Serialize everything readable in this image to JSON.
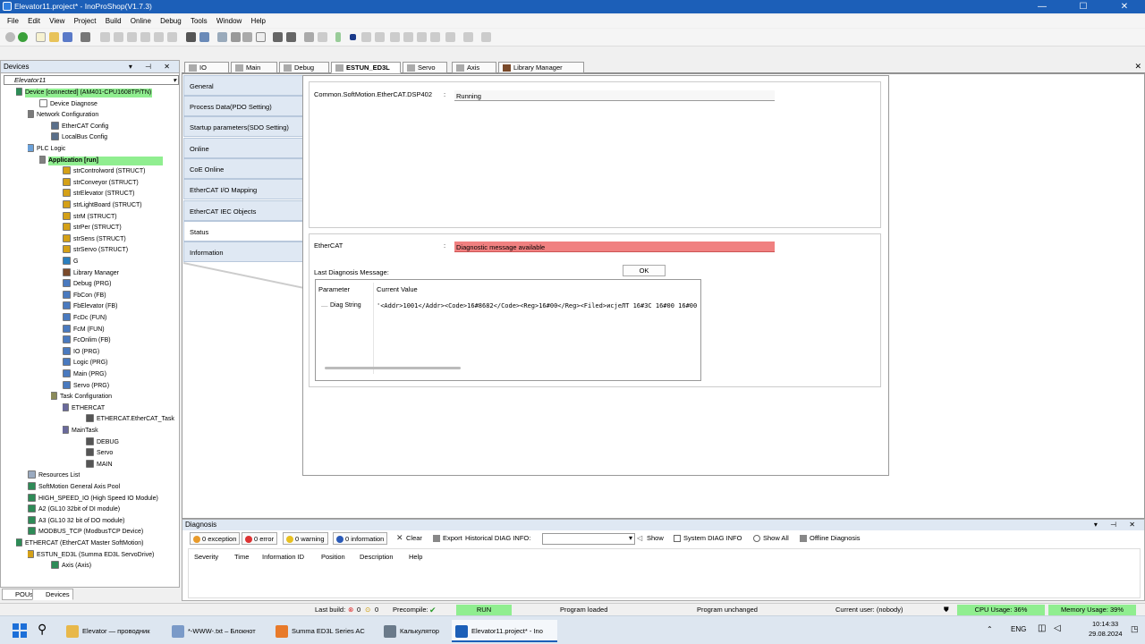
{
  "window": {
    "title": "Elevator11.project* - InoProShop(V1.7.3)",
    "minimize": "—",
    "maximize": "☐",
    "close": "✕"
  },
  "menu": [
    "File",
    "Edit",
    "View",
    "Project",
    "Build",
    "Online",
    "Debug",
    "Tools",
    "Window",
    "Help"
  ],
  "devices": {
    "title": "Devices",
    "header_controls": "▾ ⊣ ✕",
    "selector": "Elevator11",
    "tree": [
      {
        "label": "Device [connected] (AM401-CPU1608TP/TN)",
        "indent": 1,
        "expander": "−",
        "highlight": true,
        "icon": "#2e8b57"
      },
      {
        "label": "Device Diagnose",
        "indent": 3,
        "expander": "",
        "highlight": false,
        "icon": "#ffffff"
      },
      {
        "label": "Network Configuration",
        "indent": 2,
        "expander": "−",
        "highlight": false,
        "icon": "#7a7a7a"
      },
      {
        "label": "EtherCAT Config",
        "indent": 4,
        "expander": "",
        "highlight": false,
        "icon": "#5a6f8a"
      },
      {
        "label": "LocalBus Config",
        "indent": 4,
        "expander": "",
        "highlight": false,
        "icon": "#5a6f8a"
      },
      {
        "label": "PLC Logic",
        "indent": 2,
        "expander": "−",
        "highlight": false,
        "icon": "#6aa0d8"
      },
      {
        "label": "Application [run]",
        "indent": 3,
        "expander": "−",
        "highlight": true,
        "bold": true,
        "icon": "#808080"
      },
      {
        "label": "strControlword (STRUCT)",
        "indent": 5,
        "expander": "",
        "highlight": false,
        "icon": "#d4a017"
      },
      {
        "label": "strConveyor (STRUCT)",
        "indent": 5,
        "expander": "",
        "highlight": false,
        "icon": "#d4a017"
      },
      {
        "label": "strElevator (STRUCT)",
        "indent": 5,
        "expander": "",
        "highlight": false,
        "icon": "#d4a017"
      },
      {
        "label": "strLightBoard (STRUCT)",
        "indent": 5,
        "expander": "",
        "highlight": false,
        "icon": "#d4a017"
      },
      {
        "label": "strM (STRUCT)",
        "indent": 5,
        "expander": "",
        "highlight": false,
        "icon": "#d4a017"
      },
      {
        "label": "strPer (STRUCT)",
        "indent": 5,
        "expander": "",
        "highlight": false,
        "icon": "#d4a017"
      },
      {
        "label": "strSens (STRUCT)",
        "indent": 5,
        "expander": "",
        "highlight": false,
        "icon": "#d4a017"
      },
      {
        "label": "strServo (STRUCT)",
        "indent": 5,
        "expander": "",
        "highlight": false,
        "icon": "#d4a017"
      },
      {
        "label": "G",
        "indent": 5,
        "expander": "",
        "highlight": false,
        "icon": "#2a7fbf"
      },
      {
        "label": "Library Manager",
        "indent": 5,
        "expander": "",
        "highlight": false,
        "icon": "#7a4a2a"
      },
      {
        "label": "Debug (PRG)",
        "indent": 5,
        "expander": "",
        "highlight": false,
        "icon": "#4a7abf"
      },
      {
        "label": "FbCon (FB)",
        "indent": 5,
        "expander": "",
        "highlight": false,
        "icon": "#4a7abf"
      },
      {
        "label": "FbElevator (FB)",
        "indent": 5,
        "expander": "",
        "highlight": false,
        "icon": "#4a7abf"
      },
      {
        "label": "FcDc (FUN)",
        "indent": 5,
        "expander": "",
        "highlight": false,
        "icon": "#4a7abf"
      },
      {
        "label": "FcM (FUN)",
        "indent": 5,
        "expander": "",
        "highlight": false,
        "icon": "#4a7abf"
      },
      {
        "label": "FcOnlim (FB)",
        "indent": 5,
        "expander": "",
        "highlight": false,
        "icon": "#4a7abf"
      },
      {
        "label": "IO (PRG)",
        "indent": 5,
        "expander": "",
        "highlight": false,
        "icon": "#4a7abf"
      },
      {
        "label": "Logic (PRG)",
        "indent": 5,
        "expander": "",
        "highlight": false,
        "icon": "#4a7abf"
      },
      {
        "label": "Main (PRG)",
        "indent": 5,
        "expander": "",
        "highlight": false,
        "icon": "#4a7abf"
      },
      {
        "label": "Servo (PRG)",
        "indent": 5,
        "expander": "",
        "highlight": false,
        "icon": "#4a7abf"
      },
      {
        "label": "Task Configuration",
        "indent": 4,
        "expander": "−",
        "highlight": false,
        "icon": "#8a8a5a"
      },
      {
        "label": "ETHERCAT",
        "indent": 5,
        "expander": "−",
        "highlight": false,
        "icon": "#6a6a9a"
      },
      {
        "label": "ETHERCAT.EtherCAT_Task",
        "indent": 7,
        "expander": "",
        "highlight": false,
        "icon": "#555555"
      },
      {
        "label": "MainTask",
        "indent": 5,
        "expander": "−",
        "highlight": false,
        "icon": "#6a6a9a"
      },
      {
        "label": "DEBUG",
        "indent": 7,
        "expander": "",
        "highlight": false,
        "icon": "#555555"
      },
      {
        "label": "Servo",
        "indent": 7,
        "expander": "",
        "highlight": false,
        "icon": "#555555"
      },
      {
        "label": "MAIN",
        "indent": 7,
        "expander": "",
        "highlight": false,
        "icon": "#555555"
      },
      {
        "label": "Resources List",
        "indent": 2,
        "expander": "",
        "highlight": false,
        "icon": "#9aaac0"
      },
      {
        "label": "SoftMotion General Axis Pool",
        "indent": 2,
        "expander": "",
        "highlight": false,
        "icon": "#2e8b57"
      },
      {
        "label": "HIGH_SPEED_IO (High Speed IO Module)",
        "indent": 2,
        "expander": "",
        "highlight": false,
        "icon": "#2e8b57"
      },
      {
        "label": "A2 (GL10 32bit of DI module)",
        "indent": 2,
        "expander": "",
        "highlight": false,
        "icon": "#2e8b57"
      },
      {
        "label": "A3 (GL10 32 bit of DO module)",
        "indent": 2,
        "expander": "",
        "highlight": false,
        "icon": "#2e8b57"
      },
      {
        "label": "MODBUS_TCP (ModbusTCP Device)",
        "indent": 2,
        "expander": "",
        "highlight": false,
        "icon": "#2e8b57"
      },
      {
        "label": "ETHERCAT (EtherCAT Master SoftMotion)",
        "indent": 1,
        "expander": "−",
        "highlight": false,
        "icon": "#2e8b57"
      },
      {
        "label": "ESTUN_ED3L (Summa ED3L ServoDrive)",
        "indent": 2,
        "expander": "−",
        "highlight": false,
        "icon": "#d4a017"
      },
      {
        "label": "Axis (Axis)",
        "indent": 4,
        "expander": "",
        "highlight": false,
        "icon": "#2e8b57"
      }
    ],
    "bottom_tabs": [
      "POUs",
      "Devices"
    ]
  },
  "editor_tabs": [
    {
      "label": "IO",
      "active": false
    },
    {
      "label": "Main",
      "active": false
    },
    {
      "label": "Debug",
      "active": false
    },
    {
      "label": "ESTUN_ED3L",
      "active": true
    },
    {
      "label": "Servo",
      "active": false
    },
    {
      "label": "Axis",
      "active": false
    },
    {
      "label": "Library Manager",
      "active": false
    }
  ],
  "side_tabs": [
    "General",
    "Process Data(PDO Setting)",
    "Startup parameters(SDO Setting)",
    "Online",
    "CoE Online",
    "EtherCAT I/O Mapping",
    "EtherCAT IEC Objects",
    "Status",
    "Information"
  ],
  "status_page": {
    "softmotion_label": "Common.SoftMotion.EtherCAT.DSP402",
    "softmotion_value": "Running",
    "ethercat_label": "EtherCAT",
    "colon": ":",
    "ethercat_value": "Diagnostic message available",
    "ethercat_value_color": "#f08080",
    "last_diag_label": "Last Diagnosis Message:",
    "ok_button": "OK",
    "table": {
      "headers": [
        "Parameter",
        "Current Value"
      ],
      "rows": [
        [
          "Diag String",
          "'<Addr>1001</Addr><Code>16#8682</Code><Reg>16#00</Reg><Filed>исjеЛТ 16#3C 16#00 16#00"
        ]
      ]
    }
  },
  "diagnosis": {
    "title": "Diagnosis",
    "header_controls": "▾ ⊣ ✕",
    "exception": "0 exception",
    "error": "0 error",
    "warning": "0 warning",
    "information": "0 information",
    "clear": "Clear",
    "export": "Export",
    "history_label": "Historical DIAG INFO:",
    "history_value": "",
    "show": "Show",
    "system_diag": "System DIAG INFO",
    "show_all": "Show All",
    "offline_diag": "Offline Diagnosis",
    "columns": [
      "Severity",
      "Time",
      "Information ID",
      "Position",
      "Description",
      "Help"
    ]
  },
  "statusbar": {
    "last_build": "Last build:",
    "last_build_err": "0",
    "last_build_warn": "0",
    "precompile": "Precompile:",
    "run": "RUN",
    "program_loaded": "Program loaded",
    "program_unchanged": "Program unchanged",
    "current_user": "Current user: (nobody)",
    "cpu": "CPU Usage: 36%",
    "memory": "Memory Usage: 39%"
  },
  "taskbar": {
    "apps": [
      {
        "label": "Elevator — проводник",
        "icon": "#e8b84a",
        "active": false
      },
      {
        "label": "*-WWW-.txt – Блокнот",
        "icon": "#7a9ac8",
        "active": false
      },
      {
        "label": "Summa ED3L Series AC",
        "icon": "#e87a2a",
        "active": false
      },
      {
        "label": "Калькулятор",
        "icon": "#6a7a8a",
        "active": false
      },
      {
        "label": "Elevator11.project* - Ino",
        "icon": "#1c5fb8",
        "active": true
      }
    ],
    "lang": "ENG",
    "time": "10:14:33",
    "date": "29.08.2024"
  },
  "colors": {
    "accent": "#1c5fb8",
    "highlight": "#90ee90",
    "error": "#f08080"
  }
}
